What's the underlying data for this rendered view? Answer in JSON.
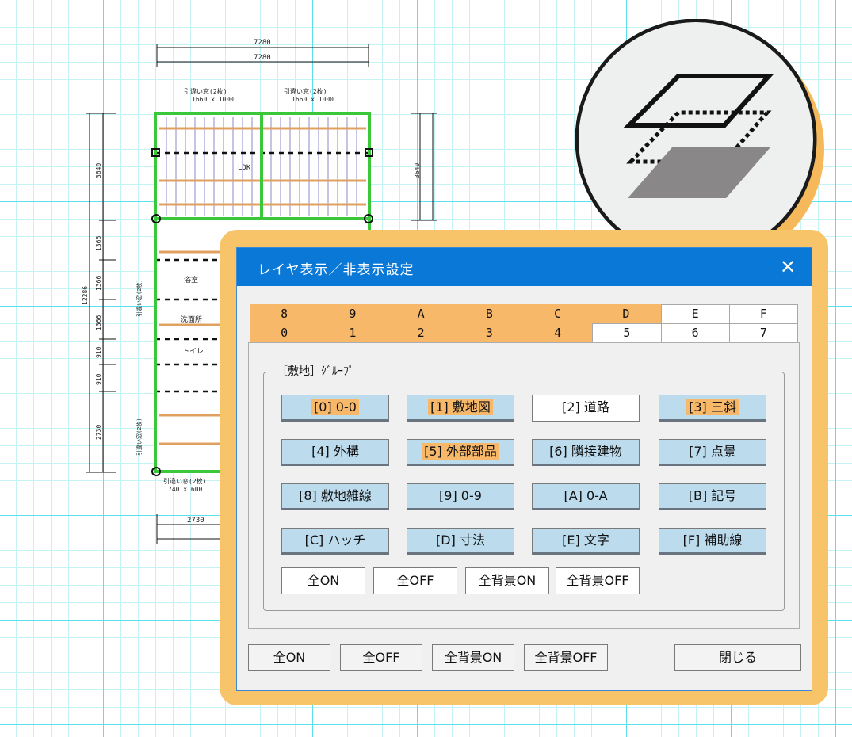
{
  "drawing": {
    "dim_top_outer": "7280",
    "dim_top_inner": "7280",
    "dim_left_total": "12286",
    "dim_left": [
      "3640",
      "1366",
      "1366",
      "1366",
      "910",
      "910",
      "2730"
    ],
    "dim_right": "3640",
    "dim_bottom": "2730",
    "windows_top": [
      "引違い窓(2枚)",
      "引違い窓(2枚)"
    ],
    "windows_top_size": [
      "1660 x 1000",
      "1660 x 1000"
    ],
    "window_bottom": "引違い窓(2枚)",
    "window_bottom_size": "740 x 600",
    "rooms": [
      "LDK",
      "浴室",
      "洗面所",
      "トイレ"
    ]
  },
  "dialog": {
    "title": "レイヤ表示／非表示設定",
    "close": "✕",
    "tabs_top": [
      {
        "label": "8",
        "on": true
      },
      {
        "label": "9",
        "on": true
      },
      {
        "label": "A",
        "on": true
      },
      {
        "label": "B",
        "on": true
      },
      {
        "label": "C",
        "on": true
      },
      {
        "label": "D",
        "on": true
      },
      {
        "label": "E",
        "on": false
      },
      {
        "label": "F",
        "on": false
      }
    ],
    "tabs_bottom": [
      {
        "label": "0",
        "on": true
      },
      {
        "label": "1",
        "on": true
      },
      {
        "label": "2",
        "on": true
      },
      {
        "label": "3",
        "on": true
      },
      {
        "label": "4",
        "on": true
      },
      {
        "label": "5",
        "on": false
      },
      {
        "label": "6",
        "on": false
      },
      {
        "label": "7",
        "on": false
      }
    ],
    "group_label": "［敷地］ｸﾞﾙｰﾌﾟ",
    "layers": [
      {
        "label": "[0] 0-0",
        "state": "hi"
      },
      {
        "label": "[1] 敷地図",
        "state": "hi"
      },
      {
        "label": "[2] 道路",
        "state": "off"
      },
      {
        "label": "[3] 三斜",
        "state": "hi"
      },
      {
        "label": "[4] 外構",
        "state": "on"
      },
      {
        "label": "[5] 外部部品",
        "state": "hi"
      },
      {
        "label": "[6] 隣接建物",
        "state": "on"
      },
      {
        "label": "[7] 点景",
        "state": "on"
      },
      {
        "label": "[8] 敷地雑線",
        "state": "on"
      },
      {
        "label": "[9] 0-9",
        "state": "on"
      },
      {
        "label": "[A] 0-A",
        "state": "on"
      },
      {
        "label": "[B] 記号",
        "state": "on"
      },
      {
        "label": "[C] ハッチ",
        "state": "on"
      },
      {
        "label": "[D] 寸法",
        "state": "on"
      },
      {
        "label": "[E] 文字",
        "state": "on"
      },
      {
        "label": "[F] 補助線",
        "state": "on"
      }
    ],
    "group_buttons": {
      "all_on": "全ON",
      "all_off": "全OFF",
      "all_bg_on": "全背景ON",
      "all_bg_off": "全背景OFF"
    },
    "bottom_buttons": {
      "all_on": "全ON",
      "all_off": "全OFF",
      "all_bg_on": "全背景ON",
      "all_bg_off": "全背景OFF",
      "close": "閉じる"
    }
  },
  "badge": {
    "icon": "layers-icon",
    "colors": {
      "shadow": "#f5b95c",
      "face": "#eef0ef",
      "layer": "#8a8788"
    }
  }
}
